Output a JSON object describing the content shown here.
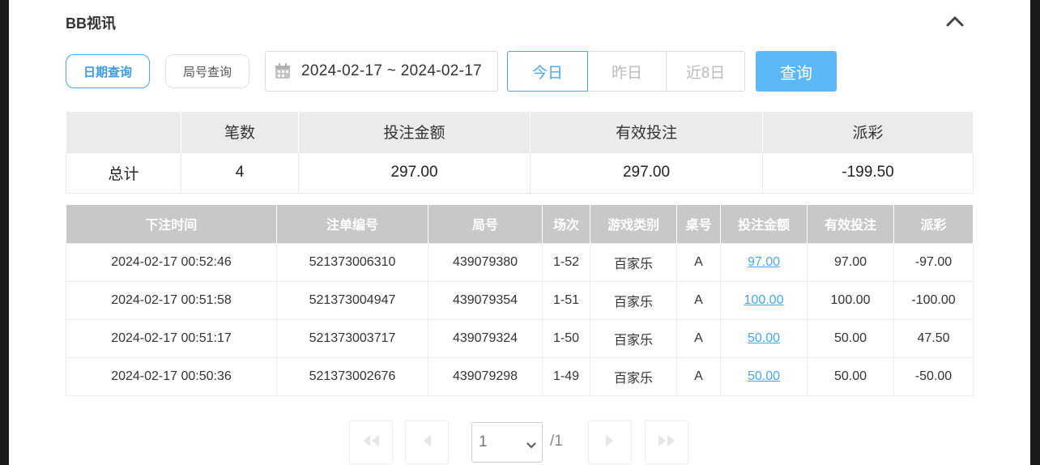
{
  "section": {
    "title": "BB视讯"
  },
  "tabs": {
    "date_query": "日期查询",
    "round_query": "局号查询"
  },
  "date_range": {
    "value": "2024-02-17 ~ 2024-02-17"
  },
  "quick": {
    "today": "今日",
    "yesterday": "昨日",
    "last8": "近8日"
  },
  "query_button": "查询",
  "summary": {
    "headers": [
      "",
      "笔数",
      "投注金额",
      "有效投注",
      "派彩"
    ],
    "row": {
      "label": "总计",
      "count": "4",
      "bet": "297.00",
      "valid": "297.00",
      "payout": "-199.50"
    }
  },
  "details": {
    "headers": [
      "下注时间",
      "注单编号",
      "局号",
      "场次",
      "游戏类别",
      "桌号",
      "投注金额",
      "有效投注",
      "派彩"
    ],
    "rows": [
      {
        "time": "2024-02-17 00:52:46",
        "order": "521373006310",
        "round": "439079380",
        "session": "1-52",
        "game": "百家乐",
        "table": "A",
        "bet": "97.00",
        "valid": "97.00",
        "payout": "-97.00"
      },
      {
        "time": "2024-02-17 00:51:58",
        "order": "521373004947",
        "round": "439079354",
        "session": "1-51",
        "game": "百家乐",
        "table": "A",
        "bet": "100.00",
        "valid": "100.00",
        "payout": "-100.00"
      },
      {
        "time": "2024-02-17 00:51:17",
        "order": "521373003717",
        "round": "439079324",
        "session": "1-50",
        "game": "百家乐",
        "table": "A",
        "bet": "50.00",
        "valid": "50.00",
        "payout": "47.50"
      },
      {
        "time": "2024-02-17 00:50:36",
        "order": "521373002676",
        "round": "439079298",
        "session": "1-49",
        "game": "百家乐",
        "table": "A",
        "bet": "50.00",
        "valid": "50.00",
        "payout": "-50.00"
      }
    ]
  },
  "pager": {
    "current": "1",
    "total": "/1"
  },
  "colors": {
    "accent": "#4aa8e8",
    "query_bg": "#5cb8f5",
    "negative": "#e8434f",
    "detail_header_bg": "#c8c8c8",
    "summary_header_bg": "#ebebeb"
  },
  "icons": {
    "collapse": "chevron-up-icon",
    "calendar": "calendar-icon",
    "first": "double-chevron-left-icon",
    "prev": "chevron-left-icon",
    "next": "chevron-right-icon",
    "last": "double-chevron-right-icon",
    "select": "chevron-down-icon"
  }
}
